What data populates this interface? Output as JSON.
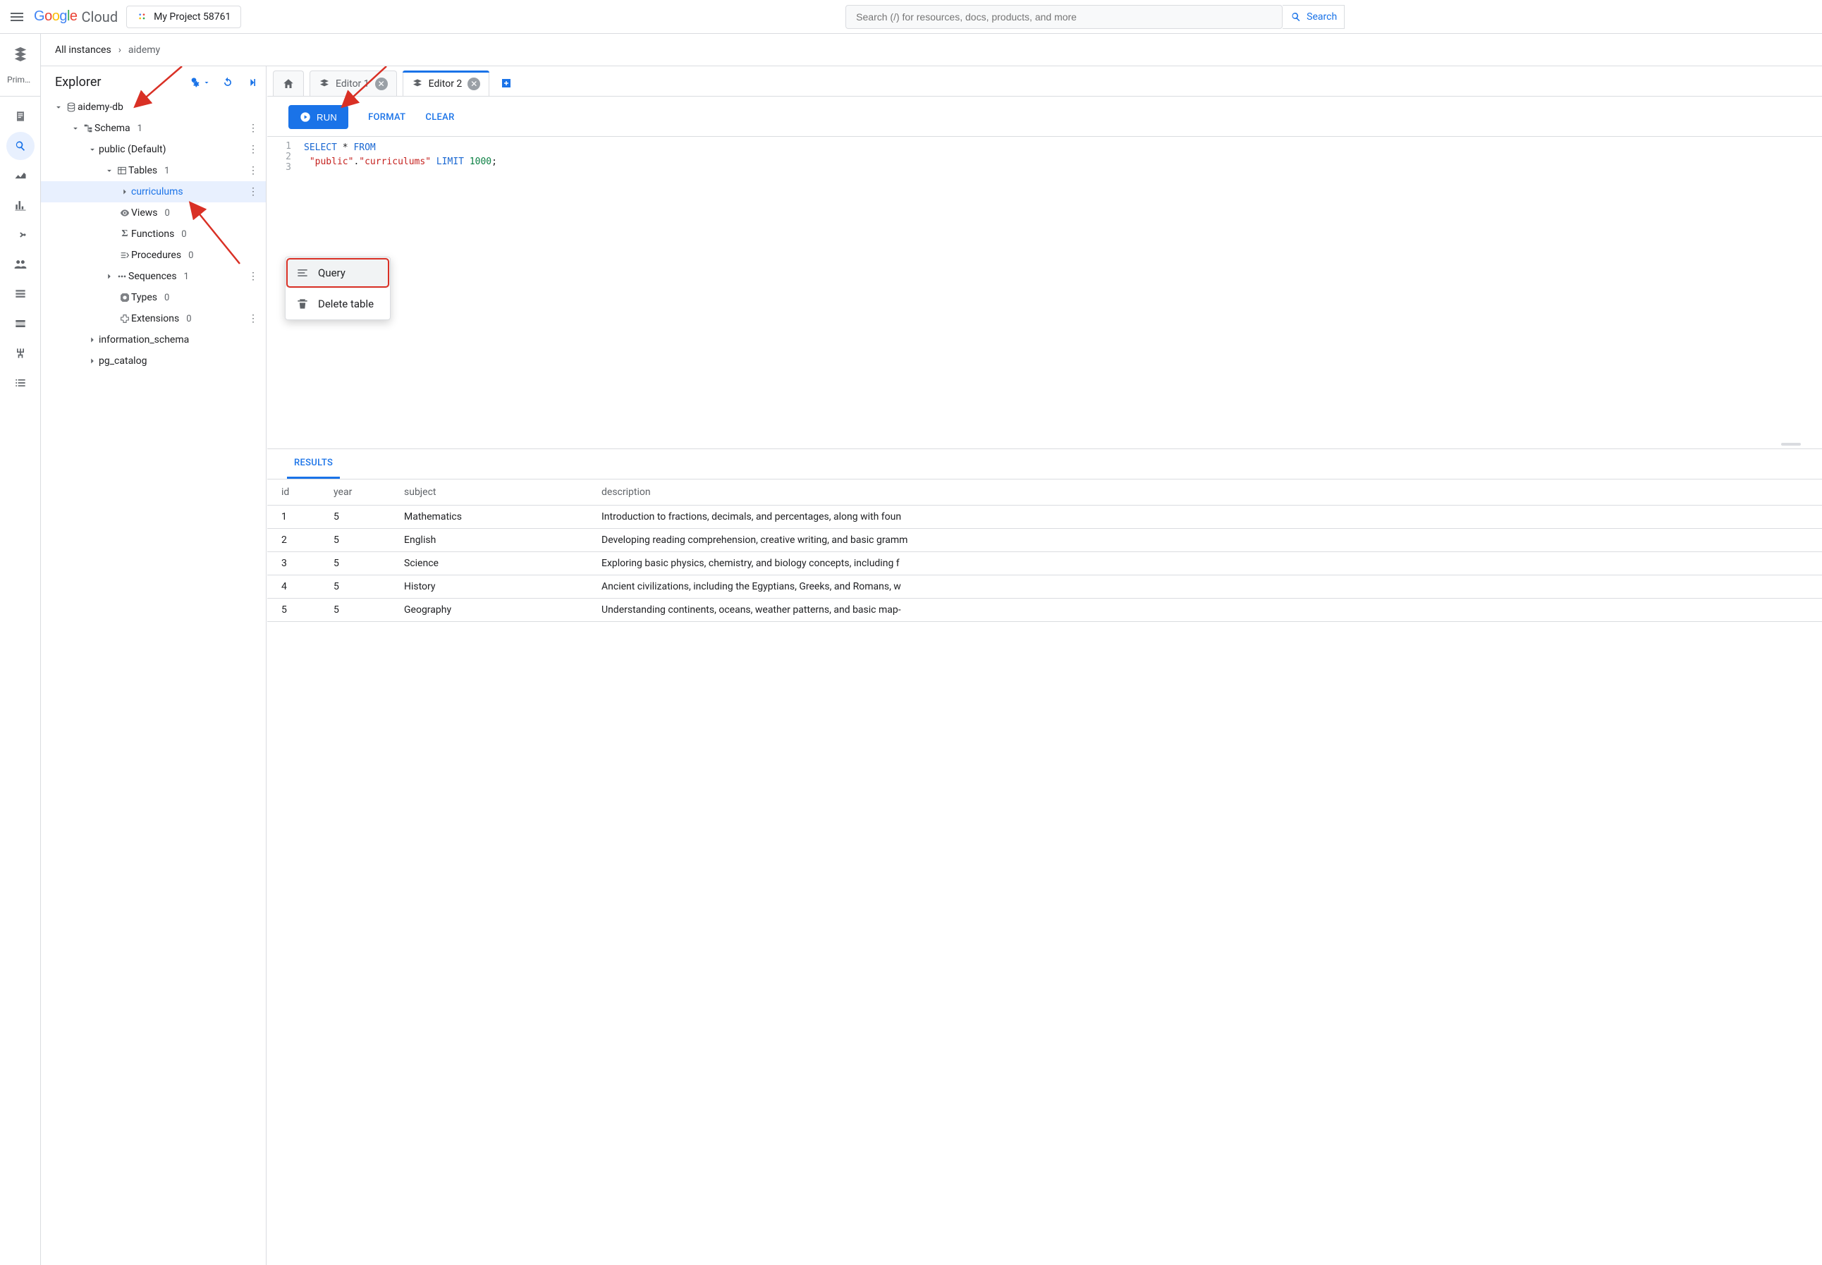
{
  "header": {
    "product": "Cloud",
    "project_label": "My Project 58761",
    "search_placeholder": "Search (/) for resources, docs, products, and more",
    "search_button": "Search"
  },
  "rail": {
    "primary_label": "Prima…"
  },
  "breadcrumb": {
    "root": "All instances",
    "current": "aidemy"
  },
  "explorer": {
    "title": "Explorer",
    "db": "aidemy-db",
    "schema_label": "Schema",
    "schema_count": "1",
    "schema_public": "public (Default)",
    "tables_label": "Tables",
    "tables_count": "1",
    "table_curriculums": "curriculums",
    "views_label": "Views",
    "views_count": "0",
    "functions_label": "Functions",
    "functions_count": "0",
    "procedures_label": "Procedures",
    "procedures_count": "0",
    "sequences_label": "Sequences",
    "sequences_count": "1",
    "types_label": "Types",
    "types_count": "0",
    "extensions_label": "Extensions",
    "extensions_count": "0",
    "info_schema": "information_schema",
    "pg_catalog": "pg_catalog"
  },
  "context_menu": {
    "query": "Query",
    "delete": "Delete table"
  },
  "tabs": {
    "editor1": "Editor 1",
    "editor2": "Editor 2"
  },
  "toolbar": {
    "run": "RUN",
    "format": "FORMAT",
    "clear": "CLEAR"
  },
  "code": {
    "l1a": "SELECT",
    "l1b": " * ",
    "l1c": "FROM",
    "l2a": " \"public\"",
    "l2b": ".",
    "l2c": "\"curriculums\"",
    "l2d": " LIMIT ",
    "l2e": "1000",
    "l2f": ";",
    "ln1": "1",
    "ln2": "2",
    "ln3": "3"
  },
  "results": {
    "tab": "RESULTS",
    "headers": {
      "id": "id",
      "year": "year",
      "subject": "subject",
      "description": "description"
    },
    "rows": [
      {
        "id": "1",
        "year": "5",
        "subject": "Mathematics",
        "description": "Introduction to fractions, decimals, and percentages, along with foun"
      },
      {
        "id": "2",
        "year": "5",
        "subject": "English",
        "description": "Developing reading comprehension, creative writing, and basic gramm"
      },
      {
        "id": "3",
        "year": "5",
        "subject": "Science",
        "description": "Exploring basic physics, chemistry, and biology concepts, including f"
      },
      {
        "id": "4",
        "year": "5",
        "subject": "History",
        "description": "Ancient civilizations, including the Egyptians, Greeks, and Romans, w"
      },
      {
        "id": "5",
        "year": "5",
        "subject": "Geography",
        "description": "Understanding continents, oceans, weather patterns, and basic map-"
      }
    ]
  }
}
